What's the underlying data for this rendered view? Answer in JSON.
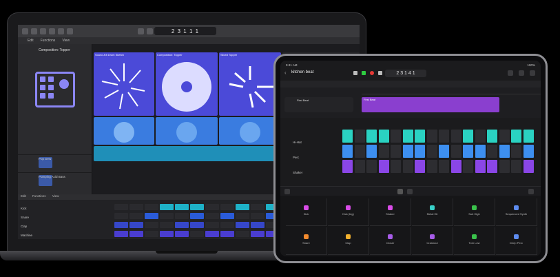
{
  "mac": {
    "lcd": "2 3 1 1 1",
    "sub_labels": [
      "Edit",
      "Functions",
      "View"
    ],
    "inspector_title": "Composition: Topper",
    "tracks": [
      {
        "label": "Pop Dew"
      },
      {
        "label": "Pumping Acid Bass"
      }
    ],
    "live_cells": [
      {
        "label": "Sound-Kit Drum Sketch"
      },
      {
        "label": "Composition: Topper"
      },
      {
        "label": "Sliced Topper"
      }
    ],
    "lower_labels": [
      "Edit",
      "Functions",
      "View"
    ],
    "seq_rows": [
      "Kick",
      "Snare",
      "Clap",
      "Machine"
    ]
  },
  "ipad": {
    "status_left": "9:41 AM",
    "status_right": "100%",
    "title": "kitchen beat",
    "lcd": "2 3 1 4 1",
    "region_label": "First Beat",
    "tracks": [
      "Hi-Hat",
      "Perc",
      "Shaker"
    ],
    "bottom_tiles": [
      {
        "label": "Kick",
        "color": "#d94ce8"
      },
      {
        "label": "Kick (big)",
        "color": "#d94ce8"
      },
      {
        "label": "Shaker",
        "color": "#d94ce8"
      },
      {
        "label": "Metal Hit",
        "color": "#38d0c8"
      },
      {
        "label": "Sub High",
        "color": "#3ac24b"
      },
      {
        "label": "Sequenced Synth",
        "color": "#5e8cf0"
      },
      {
        "label": "Snare",
        "color": "#f28a2e"
      },
      {
        "label": "Clap",
        "color": "#f2b12e"
      },
      {
        "label": "Closer",
        "color": "#a75ce8"
      },
      {
        "label": "Crashout",
        "color": "#a75ce8"
      },
      {
        "label": "Tom Low",
        "color": "#3ac24b"
      },
      {
        "label": "Deep Perc",
        "color": "#5e8cf0"
      }
    ],
    "pad_colors": {
      "hihat": "#2ad2c2",
      "perc": "#3d8ff0",
      "shaker": "#8a46e6",
      "off": "#2d2d31"
    }
  }
}
